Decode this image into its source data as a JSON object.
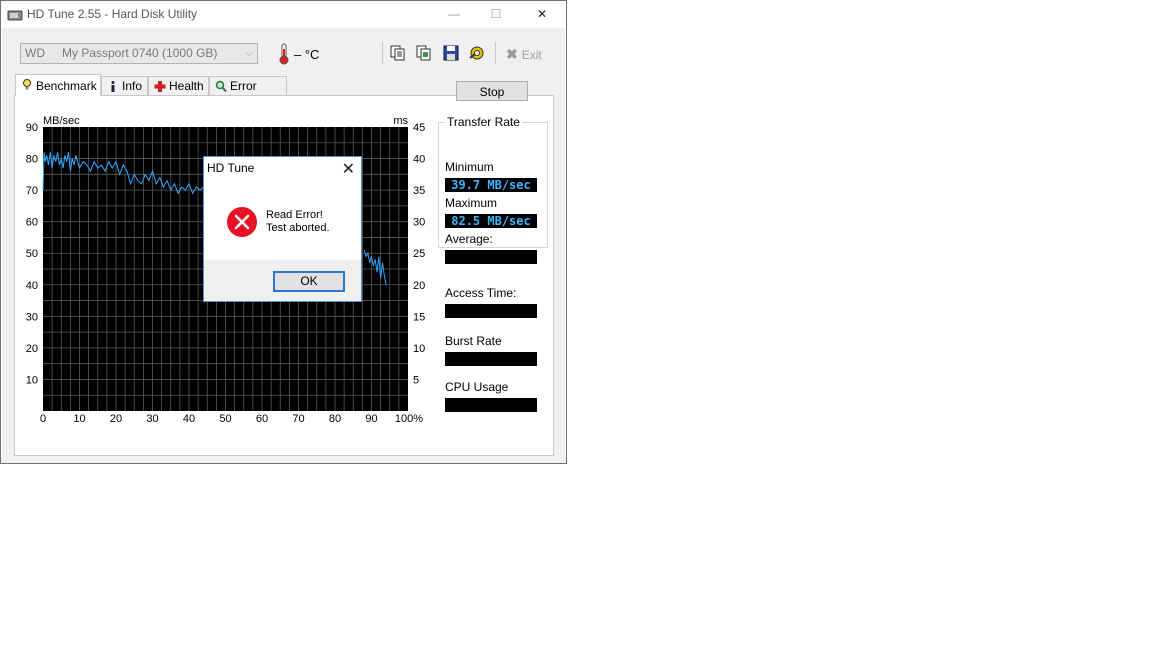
{
  "window": {
    "title": "HD Tune 2.55 - Hard Disk Utility",
    "minimize": "—",
    "maximize": "☐",
    "close": "✕"
  },
  "toolbar": {
    "drive_brand": "WD",
    "drive_name": "My Passport 0740 (1000 GB)",
    "drive_caret": "⌵",
    "temperature": "– °C",
    "exit_label": "Exit",
    "exit_icon": "✖"
  },
  "tabs": [
    {
      "label": "Benchmark",
      "icon": "lightbulb-icon"
    },
    {
      "label": "Info",
      "icon": "info-icon"
    },
    {
      "label": "Health",
      "icon": "health-cross-icon"
    },
    {
      "label": "Error Scan",
      "icon": "magnifier-icon"
    }
  ],
  "benchmark": {
    "stop_label": "Stop",
    "transfer_rate_title": "Transfer Rate",
    "minimum_label": "Minimum",
    "minimum_value": "39.7 MB/sec",
    "maximum_label": "Maximum",
    "maximum_value": "82.5 MB/sec",
    "average_label": "Average:",
    "average_value": "",
    "access_time_label": "Access Time:",
    "access_time_value": "",
    "burst_rate_label": "Burst Rate",
    "burst_rate_value": "",
    "cpu_usage_label": "CPU Usage",
    "cpu_usage_value": ""
  },
  "dialog": {
    "title": "HD Tune",
    "close": "✕",
    "message_line1": "Read Error!",
    "message_line2": "Test aborted.",
    "ok_label": "OK"
  },
  "colors": {
    "trace": "#2ea8ff",
    "chart_bg": "#000000",
    "grid": "#5a5a5a",
    "value_text": "#3cb4ff",
    "error_red": "#e81123"
  },
  "chart_data": {
    "type": "line",
    "ylabel": "MB/sec",
    "y2label": "ms",
    "xlim": [
      0,
      100
    ],
    "ylim": [
      0,
      90
    ],
    "y2lim": [
      0,
      45
    ],
    "x_ticks": [
      "0",
      "10",
      "20",
      "30",
      "40",
      "50",
      "60",
      "70",
      "80",
      "90",
      "100%"
    ],
    "y_ticks": [
      "10",
      "20",
      "30",
      "40",
      "50",
      "60",
      "70",
      "80",
      "90"
    ],
    "y2_ticks": [
      "5",
      "10",
      "15",
      "20",
      "25",
      "30",
      "35",
      "40",
      "45"
    ],
    "grid": true,
    "series": [
      {
        "x": [
          0,
          0.3,
          0.6,
          1,
          1.5,
          2,
          2.5,
          3,
          3.5,
          4,
          4.5,
          5,
          5.5,
          6,
          6.5,
          7,
          7.5,
          8,
          8.5,
          9,
          10,
          11,
          12,
          13,
          14,
          15,
          16,
          17,
          18,
          19,
          20,
          21,
          22,
          23,
          24,
          25,
          26,
          27,
          28,
          29,
          30,
          31,
          32,
          33,
          34,
          35,
          36,
          37,
          38,
          39,
          40,
          41,
          42,
          43,
          44,
          88,
          88.5,
          89,
          89.5,
          90,
          90.5,
          91,
          91.5,
          92,
          92.5,
          93,
          93.5,
          94
        ],
        "y": [
          70,
          82,
          79,
          81,
          78,
          82,
          77,
          81,
          79,
          82,
          78,
          80,
          77,
          81,
          79,
          82,
          76,
          80,
          78,
          81,
          77,
          79,
          78,
          76,
          79,
          77,
          78,
          76,
          79,
          77,
          79,
          75,
          78,
          76,
          72,
          75,
          73,
          72,
          75,
          73,
          76,
          72,
          74,
          71,
          73,
          70,
          72,
          69,
          71,
          70,
          72,
          69,
          71,
          70,
          71,
          51,
          49,
          50,
          47,
          49,
          46,
          48,
          44,
          49,
          42,
          47,
          43,
          40
        ]
      }
    ]
  }
}
